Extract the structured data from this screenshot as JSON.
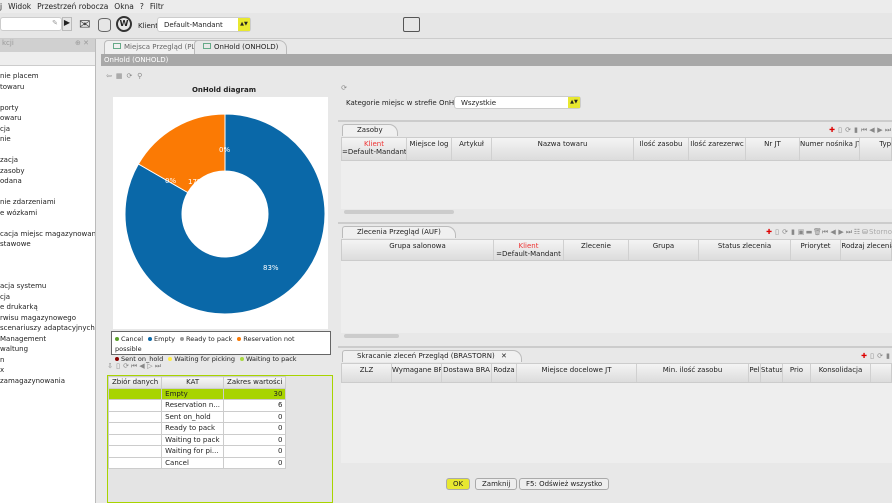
{
  "menu": [
    "j",
    "Widok",
    "Przestrzeń robocza",
    "Okna",
    "?",
    "Filtr"
  ],
  "toolbar": {
    "client_label": "Klient",
    "client_value": "Default-Mandant"
  },
  "left_panel": {
    "title": "kcji",
    "items": [
      "nie placem",
      "towaru",
      "",
      "porty",
      "owaru",
      "cja",
      "nie",
      "",
      "zacja",
      "zasoby",
      "odana",
      "",
      "nie zdarzeniami",
      "e wózkami",
      "",
      "cacja miejsc magazynowania",
      "stawowe",
      "",
      "",
      "",
      "acja systemu",
      "cja",
      "e drukarką",
      "rwisu magazynowego",
      "scenariuszy adaptacyjnych",
      "Management",
      "waltung",
      "n",
      "x",
      "zamagazynowania"
    ]
  },
  "tabs": [
    {
      "label": "Miejsca Przegląd (PL)",
      "active": false
    },
    {
      "label": "OnHold (ONHOLD)",
      "active": true
    }
  ],
  "window_title": "OnHold (ONHOLD)",
  "chart_data": {
    "type": "pie",
    "title": "OnHold diagram",
    "donut": true,
    "categories": [
      "Empty",
      "Reservation not possible",
      "Sent on_hold",
      "Ready to pack",
      "Waiting to pack",
      "Waiting for picking",
      "Cancel"
    ],
    "values": [
      30,
      6,
      0,
      0,
      0,
      0,
      0
    ],
    "labels": [
      "83%",
      "17%",
      "0%",
      "0%"
    ],
    "colors": {
      "Empty": "#0a68a8",
      "Reservation not possible": "#fb7a04",
      "Cancel": "#5aa02c",
      "Ready to pack": "#999999",
      "Sent on_hold": "#8b0000",
      "Waiting for picking": "#ffee44",
      "Waiting to pack": "#a8d840"
    },
    "legend": [
      "Cancel",
      "Empty",
      "Ready to pack",
      "Reservation not possible",
      "Sent on_hold",
      "Waiting for picking",
      "Waiting to pack"
    ],
    "legend_position": "bottom"
  },
  "data_table": {
    "headers": [
      "Zbiór danych",
      "KAT",
      "Zakres wartości"
    ],
    "rows": [
      [
        "",
        "Empty",
        "30"
      ],
      [
        "",
        "Reservation n...",
        "6"
      ],
      [
        "",
        "Sent on_hold",
        "0"
      ],
      [
        "",
        "Ready to pack",
        "0"
      ],
      [
        "",
        "Waiting to pack",
        "0"
      ],
      [
        "",
        "Waiting for pi...",
        "0"
      ],
      [
        "",
        "Cancel",
        "0"
      ]
    ]
  },
  "filter": {
    "label": "Kategorie miejsc w strefie OnHold",
    "value": "Wszystkie"
  },
  "zasoby": {
    "tab": "Zasoby",
    "columns": [
      "Klient",
      "Miejsce log",
      "Artykuł",
      "Nazwa towaru",
      "Ilość zasobu",
      "Ilość zarezerwc",
      "Nr JT",
      "Numer nośnika JT",
      "Typ JT"
    ],
    "filter": "=Default-Mandant"
  },
  "zlecenia": {
    "tab": "Zlecenia Przegląd (AUF)",
    "columns": [
      "Grupa salonowa",
      "Klient",
      "Zlecenie",
      "Grupa",
      "Status zlecenia",
      "Priorytet",
      "Rodzaj zlecenia"
    ],
    "filter": "=Default-Mandant",
    "storno": "Storno"
  },
  "skracanie": {
    "tab": "Skracanie zleceń Przegląd (BRASTORN)",
    "columns": [
      "ZLZ",
      "Wymagane BRA",
      "Dostawa BRA",
      "Rodza",
      "Miejsce docelowe JT",
      "Min. ilość zasobu",
      "Pel",
      "Status",
      "Prio",
      "Konsolidacja"
    ]
  },
  "buttons": {
    "ok": "OK",
    "close": "Zamknij",
    "refresh": "F5: Odśwież wszystko"
  }
}
